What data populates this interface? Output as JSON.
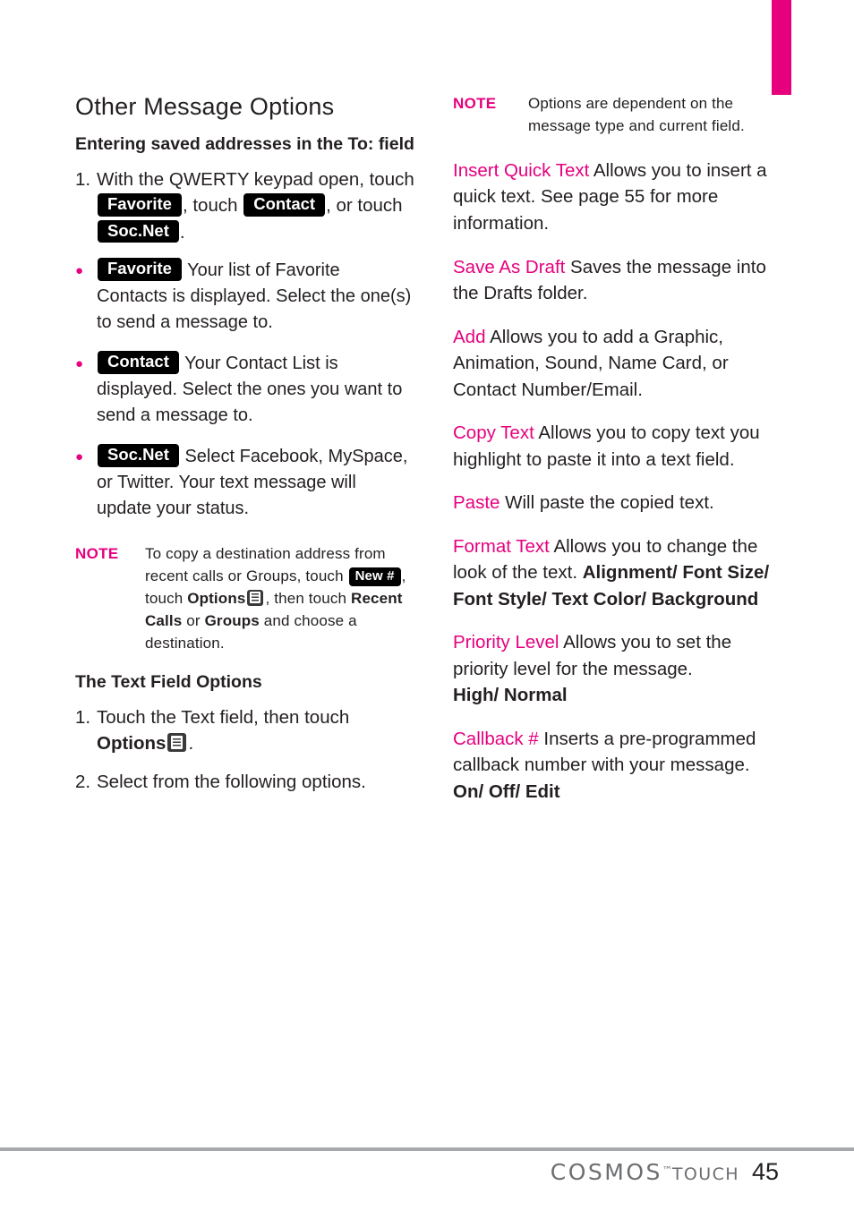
{
  "page": {
    "number": "45",
    "brand": "COSMOS",
    "brand_tm": "™",
    "brand_suffix": "TOUCH"
  },
  "left": {
    "title": "Other Message Options",
    "subhead": "Entering saved addresses in the To: field",
    "step1": {
      "num": "1.",
      "text_a": "With the QWERTY keypad open, touch",
      "key_favorite": "Favorite",
      "text_b": ", touch",
      "key_contact": "Contact",
      "text_c": ", or touch",
      "key_socnet": "Soc.Net",
      "text_d": "."
    },
    "bullets": [
      {
        "key": "Favorite",
        "text": "Your list of Favorite Contacts is displayed. Select the one(s) to send a message to."
      },
      {
        "key": "Contact",
        "text": "Your Contact List is displayed. Select the ones you want to send a message to."
      },
      {
        "key": "Soc.Net",
        "text": "Select Facebook, MySpace, or Twitter. Your text message will update your status."
      }
    ],
    "note": {
      "label": "NOTE",
      "text_a": "To copy a destination address from recent calls or Groups, touch",
      "key_newnum": "New #",
      "text_b": ", touch",
      "bold_options": "Options",
      "icon_options": "options-icon",
      "text_c": ", then touch",
      "bold_recent": "Recent Calls",
      "text_d": "or",
      "bold_groups": "Groups",
      "text_e": "and choose a destination."
    },
    "subhead2": "The Text Field Options",
    "step2": {
      "num": "1.",
      "text_a": "Touch the Text field, then touch",
      "bold_options": "Options",
      "text_b": "."
    },
    "step3": {
      "num": "2.",
      "text": "Select from the following options."
    }
  },
  "right": {
    "note": {
      "label": "NOTE",
      "text": "Options are dependent on the message type and current field."
    },
    "options": [
      {
        "name": "Insert Quick Text",
        "desc": "Allows you to insert a quick text. See page 55 for more information.",
        "values": ""
      },
      {
        "name": "Save As Draft",
        "desc": "Saves the message into the Drafts folder.",
        "values": ""
      },
      {
        "name": "Add",
        "desc": "Allows you to add a Graphic, Animation, Sound, Name Card, or Contact Number/Email.",
        "values": ""
      },
      {
        "name": "Copy Text",
        "desc": "Allows you to copy text you highlight to paste it into a text field.",
        "values": ""
      },
      {
        "name": "Paste",
        "desc": "Will paste the copied text.",
        "values": ""
      },
      {
        "name": "Format Text",
        "desc": "Allows you to change the look of the text.",
        "values": "Alignment/ Font Size/ Font Style/ Text Color/ Background"
      },
      {
        "name": "Priority Level",
        "desc": "Allows you to set the priority level for the message.",
        "values": "High/ Normal"
      },
      {
        "name": "Callback #",
        "desc": "Inserts a pre-programmed callback number with your message.",
        "values": "On/ Off/ Edit"
      }
    ]
  },
  "colors": {
    "accent": "#e6007e",
    "text": "#231f20",
    "rule": "#a7a9ac",
    "key_bg": "#000000"
  }
}
